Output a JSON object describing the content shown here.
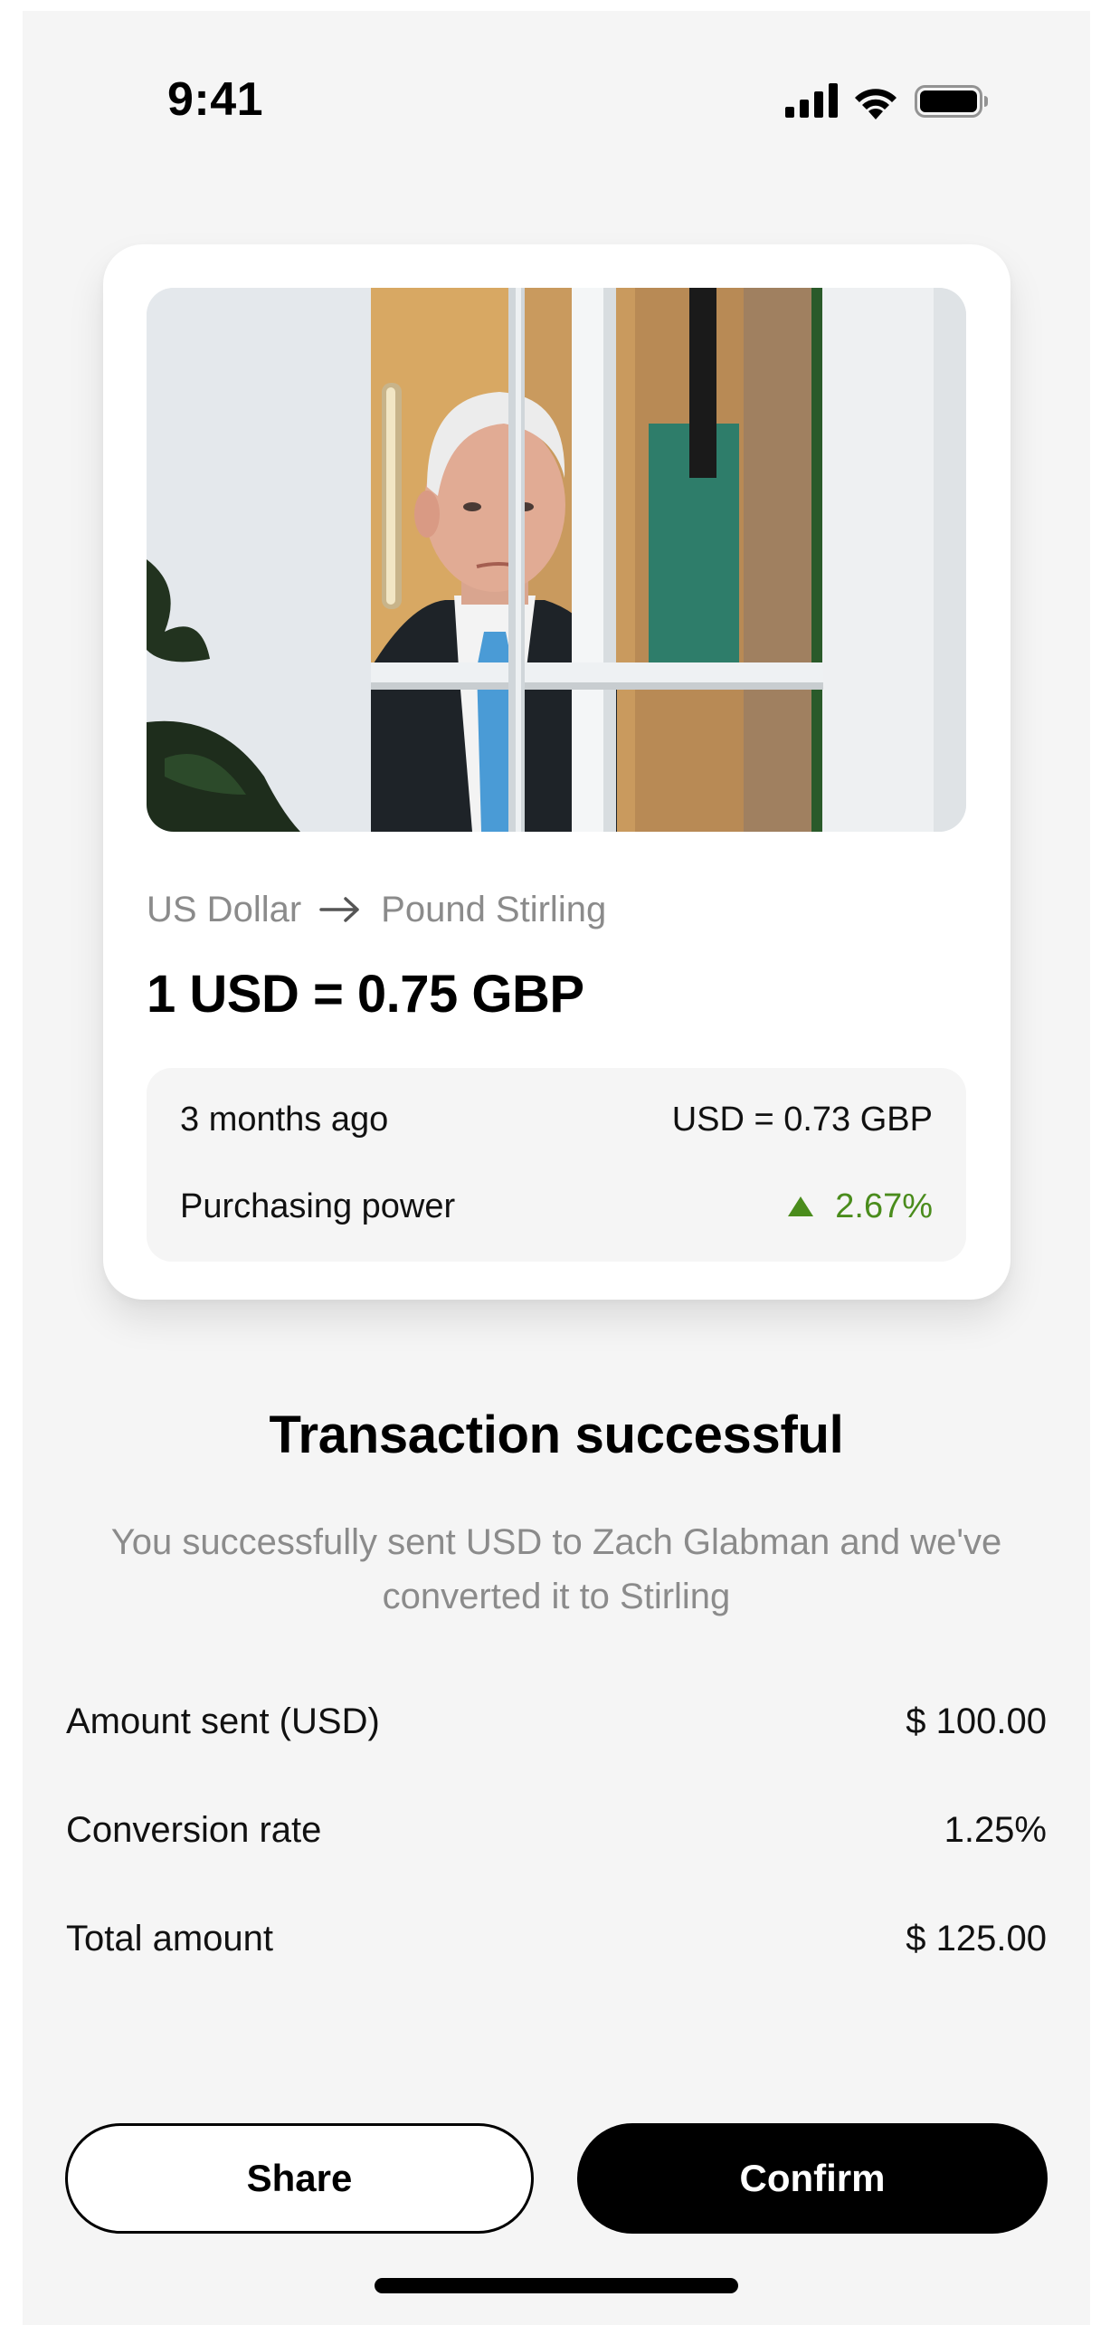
{
  "status_bar": {
    "time": "9:41",
    "icons": [
      "signal-icon",
      "wifi-icon",
      "battery-icon"
    ]
  },
  "card": {
    "photo": "portrait-photo",
    "from_currency": "US Dollar",
    "to_currency": "Pound Stirling",
    "rate": "1 USD = 0.75 GBP",
    "history": {
      "period_label": "3 months ago",
      "period_rate": "USD = 0.73 GBP",
      "power_label": "Purchasing power",
      "power_change": "2.67%",
      "change_color": "#4a8c1c"
    }
  },
  "result": {
    "title": "Transaction successful",
    "message": "You successfully sent USD to Zach Glabman and we've converted it to Stirling"
  },
  "details": [
    {
      "label": "Amount sent (USD)",
      "value": "$ 100.00"
    },
    {
      "label": "Conversion rate",
      "value": "1.25%"
    },
    {
      "label": "Total amount",
      "value": "$ 125.00"
    }
  ],
  "actions": {
    "share_label": "Share",
    "confirm_label": "Confirm"
  }
}
